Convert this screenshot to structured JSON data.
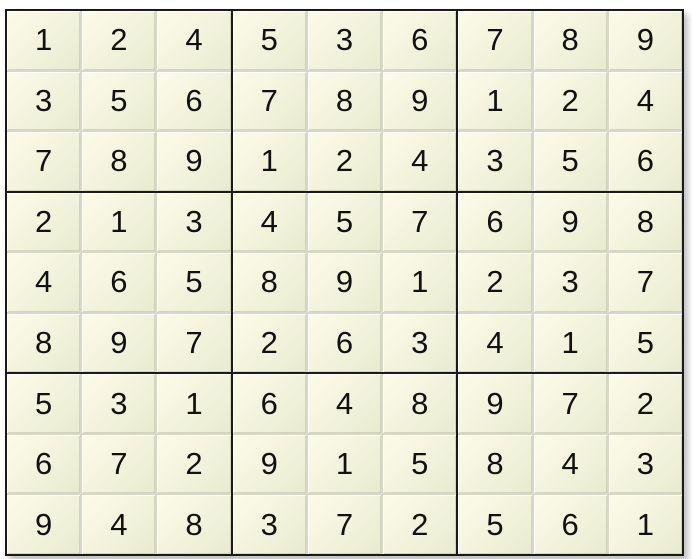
{
  "grid": [
    [
      "1",
      "2",
      "4",
      "5",
      "3",
      "6",
      "7",
      "8",
      "9"
    ],
    [
      "3",
      "5",
      "6",
      "7",
      "8",
      "9",
      "1",
      "2",
      "4"
    ],
    [
      "7",
      "8",
      "9",
      "1",
      "2",
      "4",
      "3",
      "5",
      "6"
    ],
    [
      "2",
      "1",
      "3",
      "4",
      "5",
      "7",
      "6",
      "9",
      "8"
    ],
    [
      "4",
      "6",
      "5",
      "8",
      "9",
      "1",
      "2",
      "3",
      "7"
    ],
    [
      "8",
      "9",
      "7",
      "2",
      "6",
      "3",
      "4",
      "1",
      "5"
    ],
    [
      "5",
      "3",
      "1",
      "6",
      "4",
      "8",
      "9",
      "7",
      "2"
    ],
    [
      "6",
      "7",
      "2",
      "9",
      "1",
      "5",
      "8",
      "4",
      "3"
    ],
    [
      "9",
      "4",
      "8",
      "3",
      "7",
      "2",
      "5",
      "6",
      "1"
    ]
  ],
  "colors": {
    "cell_background": "#f6f6df",
    "digit": "#111111",
    "box_border": "#1a1a1a",
    "cell_divider": "#d8d8c8"
  }
}
